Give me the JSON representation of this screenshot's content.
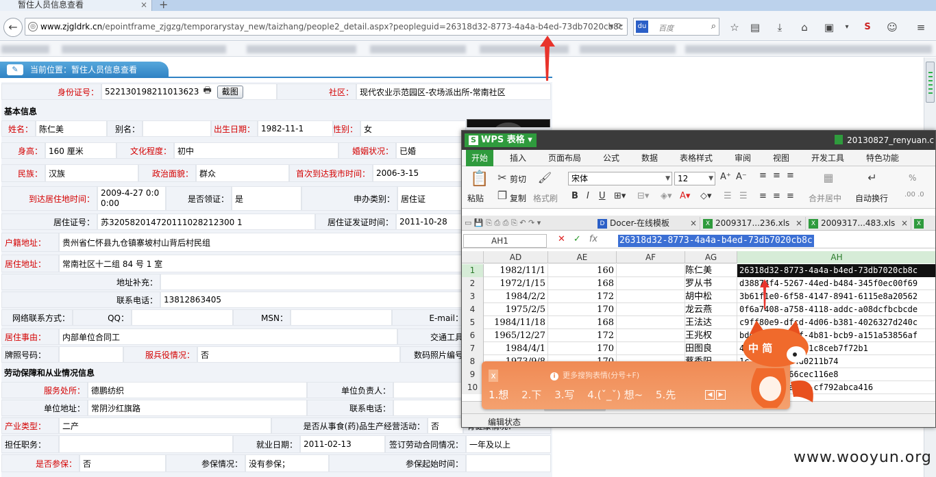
{
  "browser": {
    "tab_title": "暂住人员信息查看",
    "tab_close": "×",
    "new_tab": "+",
    "url_host": "www.zjgldrk.cn",
    "url_path": "/epointframe_zjgzg/temporarystay_new/taizhang/people2_detail.aspx?peopleguid=26318d32-8773-4a4a-b4ed-73db7020cb8c",
    "search_placeholder": "百度",
    "search_engine_label": "du"
  },
  "page": {
    "breadcrumb": "当前位置：暂住人员信息查看",
    "id": {
      "label": "身份证号：",
      "value": "522130198211013623",
      "capture_button": "截图",
      "community_label": "社区：",
      "community_value": "现代农业示范园区-农场派出所-常南社区"
    },
    "basic_section": "基本信息",
    "name_label": "姓名：",
    "name_value": "陈仁美",
    "alias_label": "别名：",
    "alias_value": "",
    "birth_label": "出生日期：",
    "birth_value": "1982-11-1",
    "gender_label": "性别：",
    "gender_value": "女",
    "height_label": "身高：",
    "height_value": "160 厘米",
    "edu_label": "文化程度：",
    "edu_value": "初中",
    "marital_label": "婚姻状况：",
    "marital_value": "已婚",
    "ethnic_label": "民族：",
    "ethnic_value": "汉族",
    "political_label": "政治面貌：",
    "political_value": "群众",
    "first_arrival_label": "首次到达我市时间：",
    "first_arrival_value": "2006-3-15",
    "arrival_label": "到达居住地时间：",
    "arrival_value_1": "2009-4-27 0:0",
    "arrival_value_2": "0:00",
    "permit_claimed_label": "是否领证：",
    "permit_claimed_value": "是",
    "apply_type_label": "申办类别：",
    "apply_type_value": "居住证",
    "permit_no_label": "居住证号：",
    "permit_no_value": "苏320582014720111028212300 1",
    "permit_date_label": "居住证发证时间：",
    "permit_date_value": "2011-10-28",
    "hukou_label": "户籍地址：",
    "hukou_value": "贵州省仁怀县九仓镇寨坡村山背后村民组",
    "residence_label": "居住地址：",
    "residence_value": "常南社区十二组 84 号 1 室",
    "addr_extra_label": "地址补充：",
    "addr_extra_value": "",
    "phone_label": "联系电话：",
    "phone_value": "13812863405",
    "net_label": "网络联系方式：",
    "qq_label": "QQ：",
    "msn_label": "MSN：",
    "email_label": "E-mail：",
    "reason_label": "居住事由：",
    "reason_value": "内部单位合同工",
    "transport_label": "交通工具",
    "plate_label": "牌照号码：",
    "plate_value": "",
    "military_label": "服兵役情况：",
    "military_value": "否",
    "photo_no_label": "数码照片编号",
    "labor_section": "劳动保障和从业情况信息",
    "work_place_label": "服务处所：",
    "work_place_value": "德鹏纺织",
    "unit_head_label": "单位负责人：",
    "unit_head_value": "",
    "unit_addr_label": "单位地址：",
    "unit_addr_value": "常阴沙红旗路",
    "unit_phone_label": "联系电话：",
    "unit_phone_value": "",
    "industry_label": "产业类型：",
    "industry_value": "二产",
    "drug_label": "是否从事食(药)品生产经营活动：",
    "drug_value": "否",
    "health_label": "有健康情况：",
    "job_label": "担任职务：",
    "job_value": "",
    "employ_date_label": "就业日期：",
    "employ_date_value": "2011-02-13",
    "contract_label": "签订劳动合同情况：",
    "contract_value": "一年及以上",
    "insured_label": "是否参保：",
    "insured_value": "否",
    "insurance_label": "参保情况：",
    "insurance_value": "没有参保；",
    "insurance_start_label": "参保起始时间："
  },
  "wps": {
    "app_name": "WPS 表格",
    "file_name": "20130827_renyuan.c",
    "menu": [
      "开始",
      "插入",
      "页面布局",
      "公式",
      "数据",
      "表格样式",
      "审阅",
      "视图",
      "开发工具",
      "特色功能"
    ],
    "ribbon": {
      "paste": "粘贴",
      "cut": "剪切",
      "copy": "复制",
      "format_painter": "格式刷",
      "font": "宋体",
      "font_size": "12",
      "merge": "合并居中",
      "wrap": "自动换行",
      "bold": "B",
      "italic": "I",
      "underline": "U",
      "percent": "%"
    },
    "doc_tabs": [
      "Docer-在线模板",
      "2009317...236.xls",
      "2009317...483.xls"
    ],
    "doc_tab_close": "×",
    "name_box": "AH1",
    "formula_value": "26318d32-8773-4a4a-b4ed-73db7020cb8c",
    "columns": [
      "AD",
      "AE",
      "AF",
      "AG",
      "AH"
    ],
    "rows": [
      {
        "n": "1",
        "ad": "1982/11/1",
        "ae": "160",
        "af": "",
        "ag": "陈仁美",
        "ah": "26318d32-8773-4a4a-b4ed-73db7020cb8c"
      },
      {
        "n": "2",
        "ad": "1972/1/15",
        "ae": "168",
        "af": "",
        "ag": "罗从书",
        "ah": "d38874f4-5267-44ed-b484-345f0ec00f69"
      },
      {
        "n": "3",
        "ad": "1984/2/2",
        "ae": "172",
        "af": "",
        "ag": "胡中松",
        "ah": "3b61f1e0-6f58-4147-8941-6115e8a20562"
      },
      {
        "n": "4",
        "ad": "1975/2/5",
        "ae": "170",
        "af": "",
        "ag": "龙云燕",
        "ah": "0f6a7408-a758-4118-addc-a08dcfbcbcde"
      },
      {
        "n": "5",
        "ad": "1984/11/18",
        "ae": "168",
        "af": "",
        "ag": "王法达",
        "ah": "c9ff80e9-dfcd-4d06-b381-4026327d240c"
      },
      {
        "n": "6",
        "ad": "1965/12/27",
        "ae": "172",
        "af": "",
        "ag": "王兆权",
        "ah": "bddbefb4-1c2f-4b81-bcb9-a151a53856af"
      },
      {
        "n": "7",
        "ad": "1984/4/1",
        "ae": "170",
        "af": "",
        "ag": "田图良",
        "ah": "47e9a0aa-b5bf-1c8ceb7f72b1"
      },
      {
        "n": "8",
        "ad": "1973/9/8",
        "ae": "170",
        "af": "",
        "ag": "蔡秀阳",
        "ah": "1c-a57c-7f14d0211b74"
      },
      {
        "n": "9",
        "ad": "",
        "ae": "",
        "af": "",
        "ag": "",
        "ah": "a0-9d4e-2366cec116e8"
      },
      {
        "n": "10",
        "ad": "",
        "ae": "",
        "af": "",
        "ag": "",
        "ah": "ad57-4c63-a07c-cf792abca416"
      }
    ],
    "status": "编辑状态"
  },
  "ime": {
    "input": "x",
    "hint": "更多搜狗表情(分号+F)",
    "candidates": [
      "1.想",
      "2.下",
      "3.写",
      "4.(ˇ_ˇ) 想~",
      "5.先"
    ],
    "mascot_label": "中 简",
    "accent": "#f08a54"
  },
  "watermark": "www.wooyun.org"
}
